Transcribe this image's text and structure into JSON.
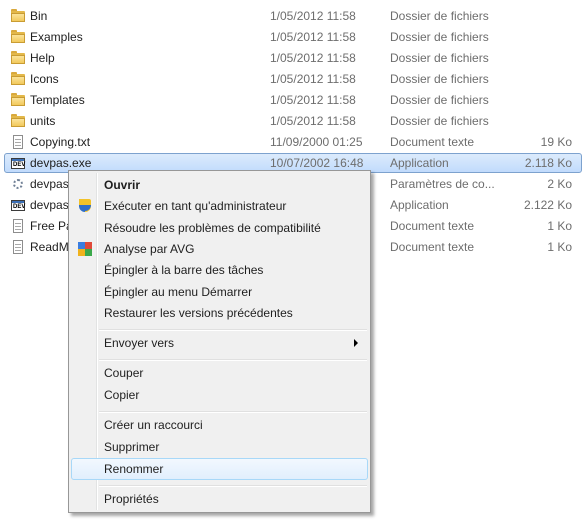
{
  "files": [
    {
      "name": "Bin",
      "date": "1/05/2012 11:58",
      "type": "Dossier de fichiers",
      "size": "",
      "icon": "folder-icon"
    },
    {
      "name": "Examples",
      "date": "1/05/2012 11:58",
      "type": "Dossier de fichiers",
      "size": "",
      "icon": "folder-icon"
    },
    {
      "name": "Help",
      "date": "1/05/2012 11:58",
      "type": "Dossier de fichiers",
      "size": "",
      "icon": "folder-icon"
    },
    {
      "name": "Icons",
      "date": "1/05/2012 11:58",
      "type": "Dossier de fichiers",
      "size": "",
      "icon": "folder-icon"
    },
    {
      "name": "Templates",
      "date": "1/05/2012 11:58",
      "type": "Dossier de fichiers",
      "size": "",
      "icon": "folder-icon"
    },
    {
      "name": "units",
      "date": "1/05/2012 11:58",
      "type": "Dossier de fichiers",
      "size": "",
      "icon": "folder-icon"
    },
    {
      "name": "Copying.txt",
      "date": "11/09/2000 01:25",
      "type": "Document texte",
      "size": "19 Ko",
      "icon": "text-file-icon"
    },
    {
      "name": "devpas.exe",
      "date": "10/07/2002 16:48",
      "type": "Application",
      "size": "2.118 Ko",
      "icon": "exe-icon",
      "selected": true
    },
    {
      "name": "devpas",
      "date": "",
      "type": "Paramètres de co...",
      "size": "2 Ko",
      "icon": "settings-file-icon"
    },
    {
      "name": "devpas",
      "date": "",
      "type": "Application",
      "size": "2.122 Ko",
      "icon": "exe-icon"
    },
    {
      "name": "Free Pa",
      "date": "",
      "type": "Document texte",
      "size": "1 Ko",
      "icon": "text-file-icon"
    },
    {
      "name": "ReadM",
      "date": "",
      "type": "Document texte",
      "size": "1 Ko",
      "icon": "text-file-icon"
    }
  ],
  "context_menu": {
    "open": "Ouvrir",
    "run_as_admin": "Exécuter en tant qu'administrateur",
    "compat": "Résoudre les problèmes de compatibilité",
    "avg_scan": "Analyse par AVG",
    "pin_taskbar": "Épingler à la barre des tâches",
    "pin_start": "Épingler au menu Démarrer",
    "restore": "Restaurer les versions précédentes",
    "send_to": "Envoyer vers",
    "cut": "Couper",
    "copy": "Copier",
    "shortcut": "Créer un raccourci",
    "delete": "Supprimer",
    "rename": "Renommer",
    "properties": "Propriétés"
  },
  "colors": {
    "selection": "#cce2fc",
    "menu_background": "#f0f0f0",
    "menu_hover": "#e1effd",
    "folder": "#f2c95c"
  }
}
